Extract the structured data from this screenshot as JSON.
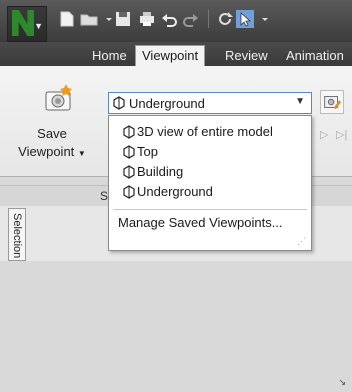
{
  "tabs": [
    "Home",
    "Viewpoint",
    "Review",
    "Animation"
  ],
  "active_tab": "Viewpoint",
  "ribbon": {
    "save_viewpoint_label_line1": "Save",
    "save_viewpoint_label_line2": "Viewpoint",
    "panel_title": "S",
    "current_viewpoint": "Underground"
  },
  "viewpoint_menu": {
    "options": [
      "3D view of entire model",
      "Top",
      "Building",
      "Underground"
    ],
    "manage_label": "Manage Saved Viewpoints..."
  },
  "side_tab_label": "Selection"
}
